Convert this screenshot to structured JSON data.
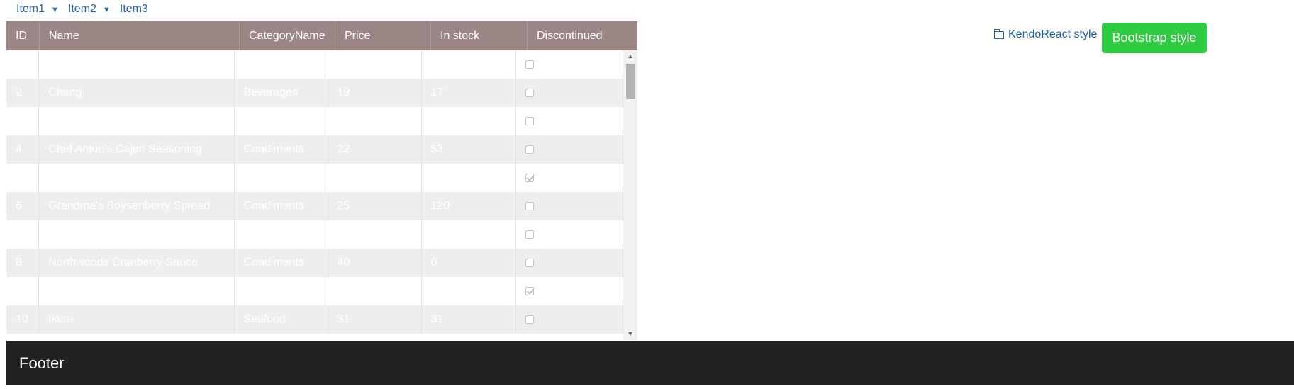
{
  "menu": {
    "items": [
      {
        "label": "Item1",
        "has_dropdown": true
      },
      {
        "label": "Item2",
        "has_dropdown": true
      },
      {
        "label": "Item3",
        "has_dropdown": false
      }
    ]
  },
  "grid": {
    "columns": [
      "ID",
      "Name",
      "CategoryName",
      "Price",
      "In stock",
      "Discontinued"
    ],
    "rows": [
      {
        "id": "",
        "name": "",
        "category": "",
        "price": "",
        "stock": "",
        "discontinued": false
      },
      {
        "id": "2",
        "name": "Chang",
        "category": "Beverages",
        "price": "19",
        "stock": "17",
        "discontinued": false
      },
      {
        "id": "",
        "name": "",
        "category": "",
        "price": "",
        "stock": "",
        "discontinued": false
      },
      {
        "id": "4",
        "name": "Chef Anton's Cajun Seasoning",
        "category": "Condiments",
        "price": "22",
        "stock": "53",
        "discontinued": false
      },
      {
        "id": "",
        "name": "",
        "category": "",
        "price": "",
        "stock": "",
        "discontinued": true
      },
      {
        "id": "6",
        "name": "Grandma's Boysenberry Spread",
        "category": "Condiments",
        "price": "25",
        "stock": "120",
        "discontinued": false
      },
      {
        "id": "",
        "name": "",
        "category": "",
        "price": "",
        "stock": "",
        "discontinued": false
      },
      {
        "id": "8",
        "name": "Northwoods Cranberry Sauce",
        "category": "Condiments",
        "price": "40",
        "stock": "6",
        "discontinued": false
      },
      {
        "id": "",
        "name": "",
        "category": "",
        "price": "",
        "stock": "",
        "discontinued": true
      },
      {
        "id": "10",
        "name": "Ikura",
        "category": "Seafood",
        "price": "31",
        "stock": "31",
        "discontinued": false
      }
    ]
  },
  "actions": {
    "kendo_label": "KendoReact style",
    "bootstrap_label": "Bootstrap style"
  },
  "footer": {
    "text": "Footer"
  },
  "colors": {
    "header_bg": "#9c8585",
    "link": "#1f5fb8",
    "bootstrap_button": "#2ecc40",
    "footer_bg": "#222222"
  }
}
